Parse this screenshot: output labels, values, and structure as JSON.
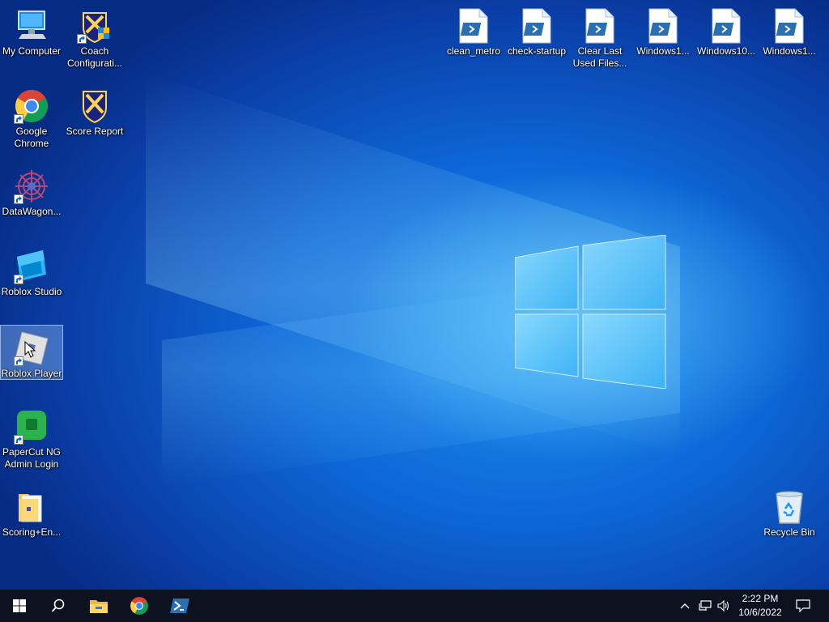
{
  "desktop": {
    "left_icons": [
      {
        "id": "my-computer",
        "label": "My Computer"
      },
      {
        "id": "coach-configuration",
        "label": "Coach Configurati..."
      },
      {
        "id": "google-chrome",
        "label": "Google Chrome"
      },
      {
        "id": "score-report",
        "label": "Score Report"
      },
      {
        "id": "datawagon",
        "label": "DataWagon..."
      },
      {
        "id": "roblox-studio",
        "label": "Roblox Studio"
      },
      {
        "id": "roblox-player",
        "label": "Roblox Player"
      },
      {
        "id": "papercut",
        "label": "PaperCut NG Admin Login"
      },
      {
        "id": "scoring-engine",
        "label": "Scoring+En..."
      }
    ],
    "top_icons": [
      {
        "id": "clean-metro",
        "label": "clean_metro"
      },
      {
        "id": "check-startup",
        "label": "check-startup"
      },
      {
        "id": "clear-last-used",
        "label": "Clear Last Used Files..."
      },
      {
        "id": "windows1-a",
        "label": "Windows1..."
      },
      {
        "id": "windows10",
        "label": "Windows10..."
      },
      {
        "id": "windows1-b",
        "label": "Windows1..."
      }
    ],
    "recycle_bin": {
      "label": "Recycle Bin"
    }
  },
  "taskbar": {
    "buttons": [
      "start-icon",
      "search-icon",
      "file-explorer-icon",
      "chrome-icon",
      "powershell-icon"
    ],
    "tray_icons": [
      "chevron-up-icon",
      "network-icon",
      "volume-icon",
      "notification-icon"
    ],
    "clock": {
      "time": "2:22 PM",
      "date": "10/6/2022"
    }
  },
  "colors": {
    "accent": "#0d66d6",
    "taskbar": "#0c1220"
  }
}
